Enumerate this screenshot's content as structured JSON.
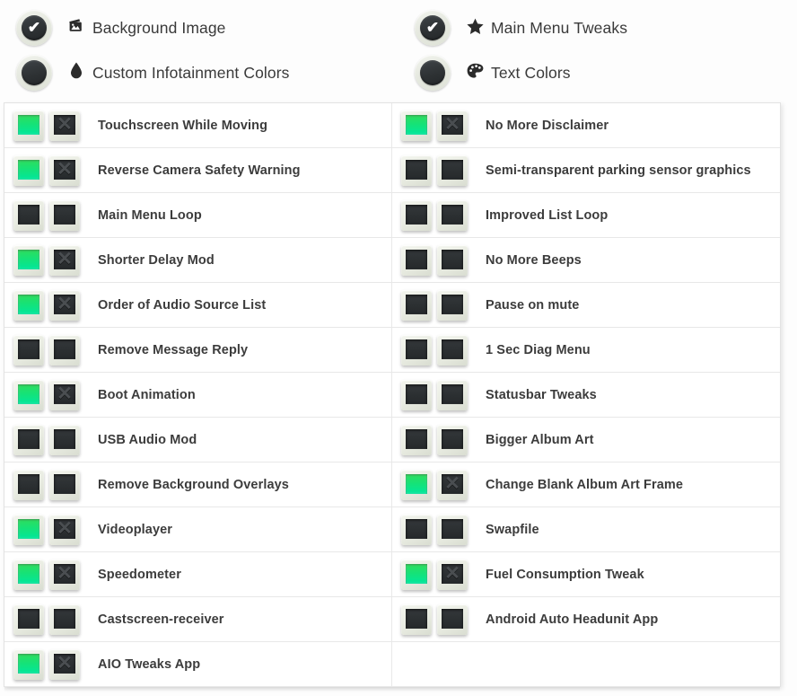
{
  "header": {
    "items": [
      {
        "label": "Background Image",
        "icon": "images-stack-icon",
        "glyph": "ὛB",
        "checked": true,
        "column": "left"
      },
      {
        "label": "Custom Infotainment Colors",
        "icon": "droplet-icon",
        "glyph": "Ὂ7",
        "checked": false,
        "column": "left"
      },
      {
        "label": "Main Menu Tweaks",
        "icon": "star-icon",
        "glyph": "★",
        "checked": true,
        "column": "right"
      },
      {
        "label": "Text Colors",
        "icon": "palette-icon",
        "glyph": "Ἲ8",
        "checked": false,
        "column": "right"
      }
    ]
  },
  "colors": {
    "accent_green_top": "#2fdd5c",
    "accent_green_bottom": "#00e79c",
    "toggle_frame": "#e9ece2",
    "toggle_face_dark": "#2b2f31",
    "panel_background": "#ffffff",
    "page_background": "#fdfdfd",
    "row_divider": "#e8e8e8",
    "label_text": "#3c3c3c"
  },
  "list": {
    "left_column": [
      {
        "label": "Touchscreen While Moving",
        "enabled": true
      },
      {
        "label": "Reverse Camera Safety Warning",
        "enabled": true
      },
      {
        "label": "Main Menu Loop",
        "enabled": false
      },
      {
        "label": "Shorter Delay Mod",
        "enabled": true
      },
      {
        "label": "Order of Audio Source List",
        "enabled": true
      },
      {
        "label": "Remove Message Reply",
        "enabled": false
      },
      {
        "label": "Boot Animation",
        "enabled": true
      },
      {
        "label": "USB Audio Mod",
        "enabled": false
      },
      {
        "label": "Remove Background Overlays",
        "enabled": false
      },
      {
        "label": "Videoplayer",
        "enabled": true
      },
      {
        "label": "Speedometer",
        "enabled": true
      },
      {
        "label": "Castscreen-receiver",
        "enabled": false
      },
      {
        "label": "AIO Tweaks App",
        "enabled": true
      }
    ],
    "right_column": [
      {
        "label": "No More Disclaimer",
        "enabled": true
      },
      {
        "label": "Semi-transparent parking sensor graphics",
        "enabled": false
      },
      {
        "label": "Improved List Loop",
        "enabled": false
      },
      {
        "label": "No More Beeps",
        "enabled": false
      },
      {
        "label": "Pause on mute",
        "enabled": false
      },
      {
        "label": "1 Sec Diag Menu",
        "enabled": false
      },
      {
        "label": "Statusbar Tweaks",
        "enabled": false
      },
      {
        "label": "Bigger Album Art",
        "enabled": false
      },
      {
        "label": "Change Blank Album Art Frame",
        "enabled": true
      },
      {
        "label": "Swapfile",
        "enabled": false
      },
      {
        "label": "Fuel Consumption Tweak",
        "enabled": true
      },
      {
        "label": "Android Auto Headunit App",
        "enabled": false
      },
      {
        "label": "",
        "enabled": null
      }
    ]
  }
}
